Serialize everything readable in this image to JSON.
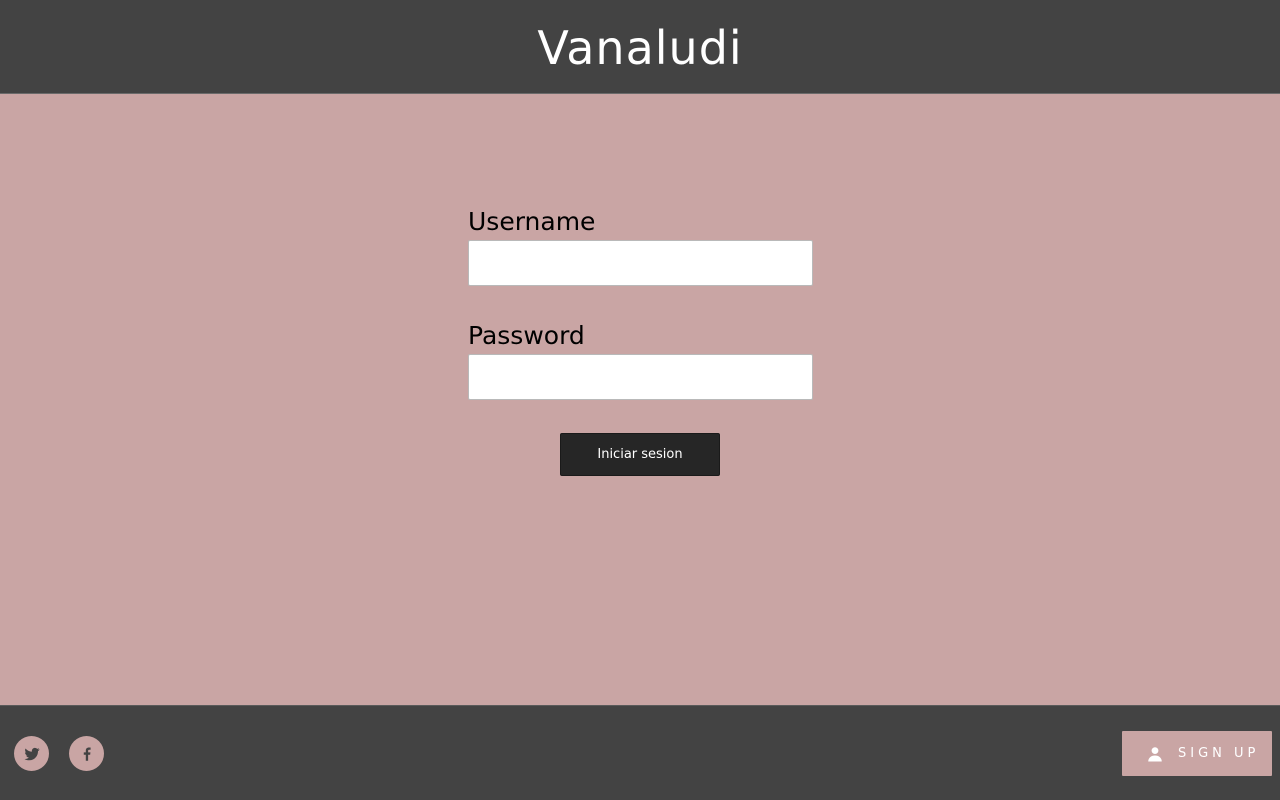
{
  "header": {
    "title": "Vanaludi"
  },
  "login_form": {
    "username_label": "Username",
    "username_value": "",
    "password_label": "Password",
    "password_value": "",
    "submit_label": "Iniciar sesion"
  },
  "footer": {
    "social": [
      {
        "icon": "twitter-icon"
      },
      {
        "icon": "facebook-icon"
      }
    ],
    "signup_icon": "user-icon",
    "signup_label": "SIGN UP"
  },
  "colors": {
    "header_bg": "#434343",
    "main_bg": "#c9a5a4",
    "button_bg": "#262626",
    "accent": "#c9a5a4"
  }
}
